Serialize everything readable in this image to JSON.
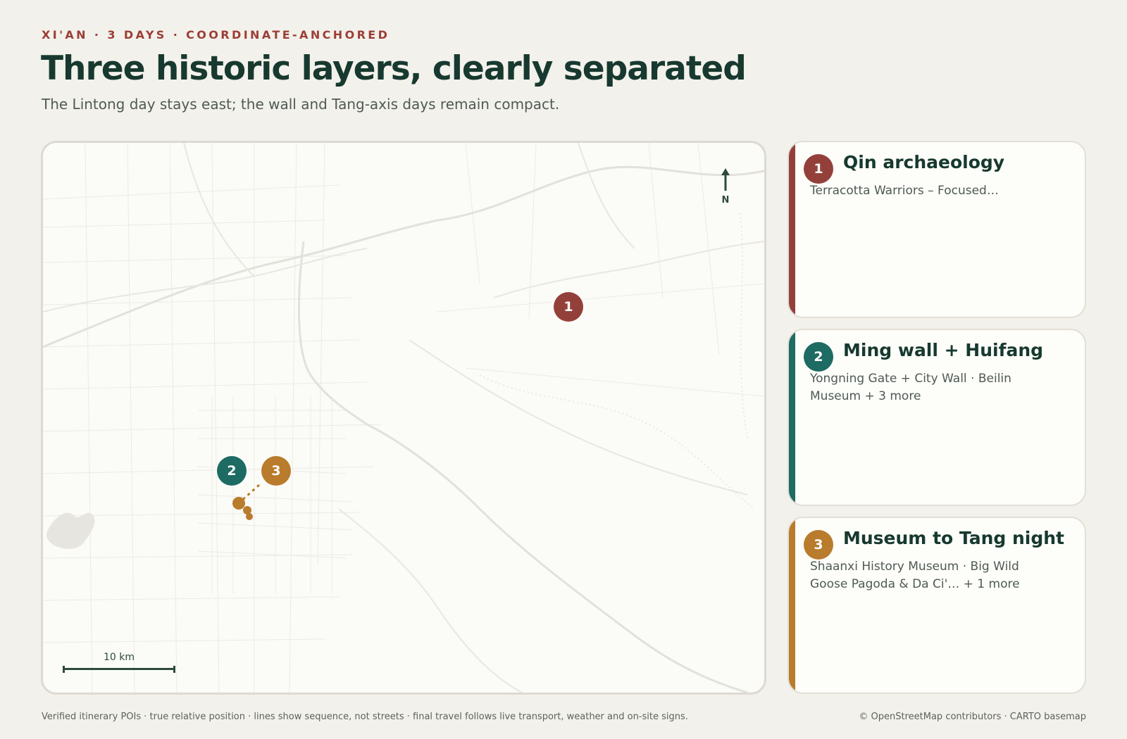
{
  "header": {
    "kicker": "XI'AN · 3 DAYS · COORDINATE-ANCHORED",
    "title": "Three historic layers, clearly separated",
    "subtitle": "The Lintong day stays east; the wall and Tang-axis days remain compact."
  },
  "colors": {
    "day1": "#94403a",
    "day2": "#1d6b62",
    "day3": "#b97b2c",
    "background": "#f3f1eb",
    "title": "#17392f",
    "kicker": "#9b3e36"
  },
  "map": {
    "north_label": "N",
    "scale_label": "10 km",
    "markers": [
      {
        "label": "1",
        "day": 1
      },
      {
        "label": "2",
        "day": 2
      },
      {
        "label": "3",
        "day": 3
      }
    ]
  },
  "days": [
    {
      "number": "1",
      "title": "Qin archaeology",
      "desc": "Terracotta Warriors – Focused…"
    },
    {
      "number": "2",
      "title": "Ming wall + Huifang",
      "desc": "Yongning Gate + City Wall · Beilin Museum + 3 more"
    },
    {
      "number": "3",
      "title": "Museum to Tang night",
      "desc": "Shaanxi History Museum · Big Wild Goose Pagoda & Da Ci'… + 1 more"
    }
  ],
  "footer": {
    "note": "Verified itinerary POIs · true relative position · lines show sequence, not streets · final travel follows live transport, weather and on-site signs.",
    "attribution": "© OpenStreetMap contributors · CARTO basemap"
  }
}
